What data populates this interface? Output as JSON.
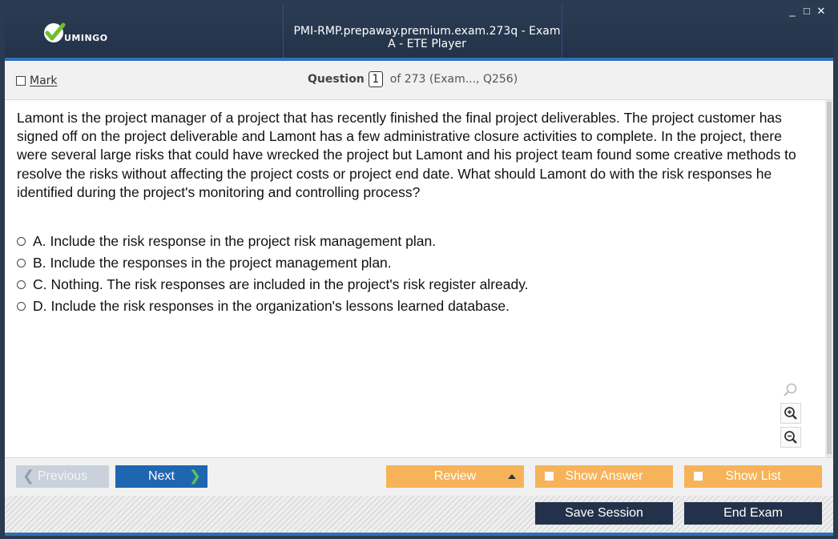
{
  "window": {
    "brand": "UMINGO",
    "title": "PMI-RMP.prepaway.premium.exam.273q - Exam A - ETE Player",
    "controls": [
      "_",
      "□",
      "✕"
    ]
  },
  "header": {
    "mark_label": "Mark",
    "question_word": "Question",
    "question_number": "1",
    "question_of": "of 273 (Exam..., Q256)"
  },
  "question": {
    "text": "Lamont is the project manager of a project that has recently finished the final project deliverables. The project customer has signed off on the project deliverable and Lamont has a few administrative closure activities to complete. In the project, there were several large risks that could have wrecked the project but Lamont and his project team found some creative methods to resolve the risks without affecting the project costs or project end date. What should Lamont do with the risk responses he identified during the project's monitoring and controlling process?",
    "answers": [
      {
        "letter": "A.",
        "text": "Include the risk response in the project risk management plan."
      },
      {
        "letter": "B.",
        "text": "Include the responses in the project management plan."
      },
      {
        "letter": "C.",
        "text": "Nothing. The risk responses are included in the project's risk register already."
      },
      {
        "letter": "D.",
        "text": "Include the risk responses in the organization's lessons learned database."
      }
    ]
  },
  "toolbar": {
    "previous_label": "Previous",
    "next_label": "Next",
    "review_label": "Review",
    "show_answer_label": "Show Answer",
    "show_list_label": "Show List",
    "save_session_label": "Save Session",
    "end_exam_label": "End Exam"
  },
  "icons": {
    "zoom": [
      "search-icon",
      "zoom-in-icon",
      "zoom-out-icon"
    ],
    "brand": "checkmark-logo-icon"
  },
  "colors": {
    "titlebar": "#22324a",
    "accent_blue": "#1f66b1",
    "orange": "#f6b35a",
    "dark_button": "#23324a",
    "logo_green": "#6fbf2a"
  }
}
